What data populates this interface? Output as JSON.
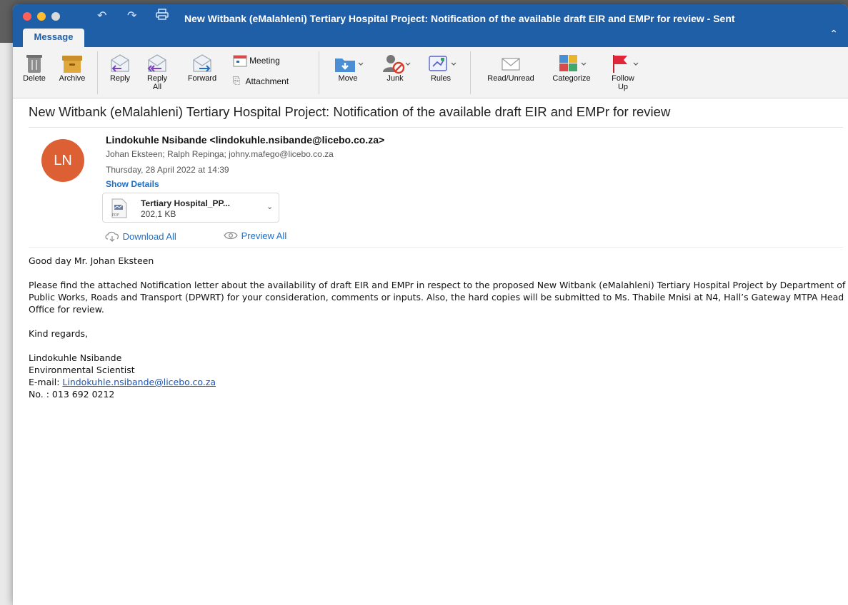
{
  "window": {
    "title": "New Witbank (eMalahleni) Tertiary Hospital Project: Notification of the available draft EIR and EMPr for review - Sent",
    "tab": "Message"
  },
  "toolbar": {
    "delete": "Delete",
    "archive": "Archive",
    "reply": "Reply",
    "reply_all_1": "Reply",
    "reply_all_2": "All",
    "forward": "Forward",
    "meeting": "Meeting",
    "attachment": "Attachment",
    "move": "Move",
    "junk": "Junk",
    "rules": "Rules",
    "read_unread": "Read/Unread",
    "categorize": "Categorize",
    "follow_up_1": "Follow",
    "follow_up_2": "Up"
  },
  "colors": {
    "titlebar": "#1f5fa8",
    "avatar": "#dd5f34",
    "link": "#1f6fc4"
  },
  "email": {
    "subject": "New Witbank (eMalahleni) Tertiary Hospital Project: Notification of the available draft EIR and EMPr for review",
    "avatar_initials": "LN",
    "sender": "Lindokuhle Nsibande <lindokuhle.nsibande@licebo.co.za>",
    "recipients": "Johan Eksteen;  Ralph Repinga;  johny.mafego@licebo.co.za",
    "date": "Thursday, 28 April 2022 at 14:39",
    "show_details": "Show Details",
    "attachment": {
      "name": "Tertiary Hospital_PP...",
      "size": "202,1 KB",
      "type_label": "PDF"
    },
    "download_all": "Download All",
    "preview_all": "Preview All",
    "body": {
      "greeting": "Good day Mr. Johan Eksteen",
      "paragraph": "Please find the attached Notification letter about the availability of draft EIR and EMPr in respect to the proposed New Witbank (eMalahleni) Tertiary Hospital Project by Department of Public Works, Roads and Transport (DPWRT) for your consideration, comments or inputs. Also, the hard copies will be submitted to Ms. Thabile Mnisi at N4, Hall’s Gateway MTPA Head Office for review.",
      "closing": "Kind regards,",
      "sig_name": "Lindokuhle Nsibande",
      "sig_title": "Environmental Scientist",
      "sig_email_label": "E-mail: ",
      "sig_email": "Lindokuhle.nsibande@licebo.co.za",
      "sig_phone": "No. : 013 692 0212"
    }
  }
}
